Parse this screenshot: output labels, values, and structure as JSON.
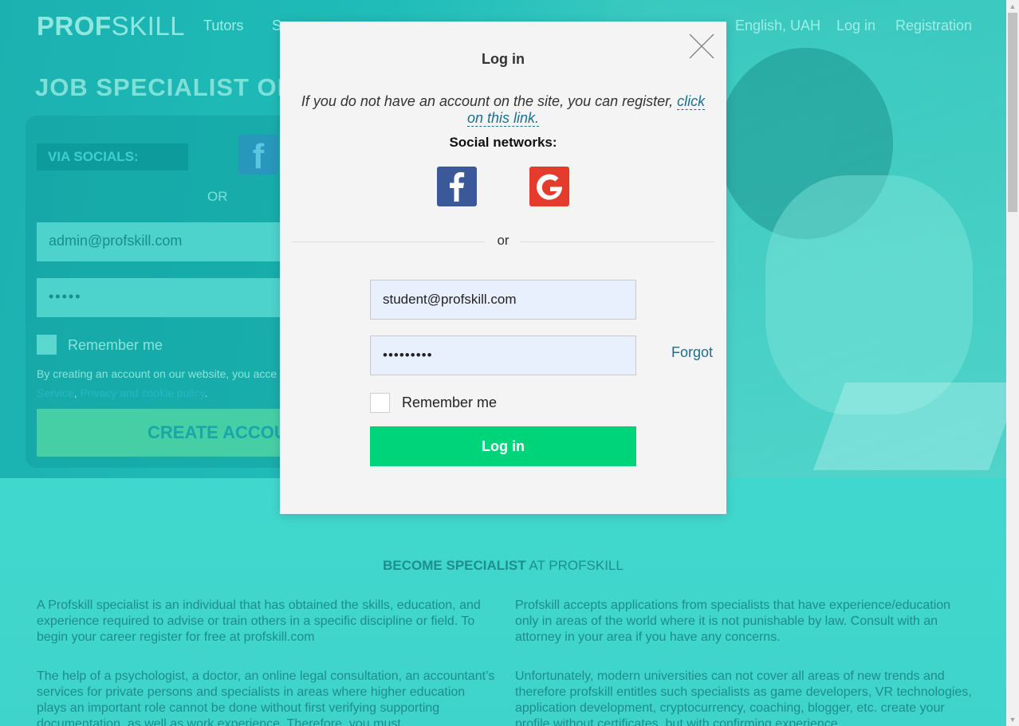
{
  "header": {
    "logo_bold": "PROF",
    "logo_light": "SKILL",
    "nav": [
      "Tutors",
      "S"
    ],
    "lang": "English, UAH",
    "login_link": "Log in",
    "register_link": "Registration"
  },
  "hero": {
    "title": "JOB SPECIALIST ONLI",
    "via_socials": "VIA SOCIALS:",
    "or": "OR",
    "email_value": "admin@profskill.com",
    "password_dots": "•••••",
    "remember": "Remember me",
    "terms_text": "By creating an account on our website, you acce",
    "terms_link1": "Service",
    "terms_sep": ", ",
    "terms_link2": "Privacy and cookie policy",
    "terms_end": ".",
    "create_button": "CREATE ACCOUN"
  },
  "section": {
    "title_bold": "BECOME SPECIALIST",
    "title_rest": " AT PROFSKILL",
    "para1": "A Profskill specialist is an individual that has obtained the skills, education, and experience required to advise or train others in a specific discipline or field. To begin your career register for free at profskill.com",
    "para2": "Profskill accepts applications from specialists that have experience/education only in areas of the world where it is not punishable by law. Consult with an attorney in your area if you have any concerns.",
    "para3": "The help of a psychologist, a doctor, an online legal consultation, an accountant’s services for private persons and specialists in areas where higher education plays an important role cannot be done without first verifying supporting documentation, as well as work experience. Therefore, you must",
    "para4": "Unfortunately, modern universities can not cover all areas of new trends and therefore profskill entitles such specialists as game developers, VR technologies, application development, cryptocurrency, coaching, blogger, etc. create your profile without certificates, but with confirming experience"
  },
  "modal": {
    "title": "Log in",
    "info_text": "If you do not have an account on the site, you can register, ",
    "info_link": "click on this link.",
    "social_label": "Social networks:",
    "or": "or",
    "email_value": "student@profskill.com",
    "password_value": "password1",
    "forgot": "Forgot",
    "remember": "Remember me",
    "login_button": "Log in"
  },
  "colors": {
    "facebook": "#3b5998",
    "google": "#e53b2c",
    "login_button": "#00d47a",
    "link": "#1c6f8f"
  },
  "icons": [
    "close-icon",
    "facebook-icon",
    "google-icon"
  ]
}
